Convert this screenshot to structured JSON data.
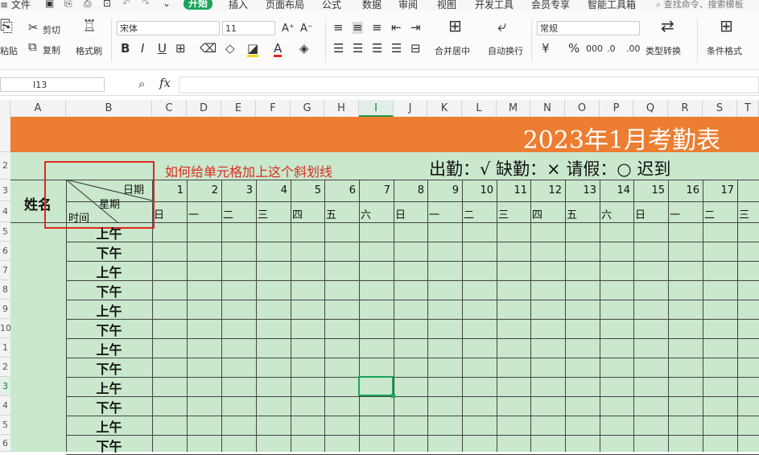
{
  "menu": {
    "file": "文件",
    "tabs": [
      "开始",
      "插入",
      "页面布局",
      "公式",
      "数据",
      "审阅",
      "视图",
      "开发工具",
      "会员专享",
      "智能工具箱"
    ],
    "search_placeholder": "查找命令、搜索模板"
  },
  "ribbon": {
    "paste": "粘贴",
    "cut": "剪切",
    "copy": "复制",
    "format_painter": "格式刷",
    "font_name": "宋体",
    "font_size": "11",
    "merge_center": "合并居中",
    "wrap_text": "自动换行",
    "number_format": "常规",
    "type_convert": "类型转换",
    "conditional_format": "条件格式"
  },
  "formula_bar": {
    "name_box": "I13",
    "fx": "fx",
    "value": ""
  },
  "columns": [
    "A",
    "B",
    "C",
    "D",
    "E",
    "F",
    "G",
    "H",
    "I",
    "J",
    "K",
    "L",
    "M",
    "N",
    "O",
    "P",
    "Q",
    "R",
    "S",
    "T"
  ],
  "selected_column": "I",
  "row_numbers": [
    "",
    "2",
    "3",
    "4",
    "5",
    "6",
    "7",
    "8",
    "9",
    "10",
    "1",
    "2",
    "3",
    "4",
    "5",
    "6"
  ],
  "sheet": {
    "title": "2023年1月考勤表",
    "annotation": "如何给单元格加上这个斜划线",
    "legend": "出勤：√   缺勤：×  请假：○  迟到",
    "name_header": "姓名",
    "diag_date": "日期",
    "diag_weekday": "星期",
    "diag_time": "时间",
    "days": [
      "1",
      "2",
      "3",
      "4",
      "5",
      "6",
      "7",
      "8",
      "9",
      "10",
      "11",
      "12",
      "13",
      "14",
      "15",
      "16",
      "17"
    ],
    "weekdays": [
      "日",
      "一",
      "二",
      "三",
      "四",
      "五",
      "六",
      "日",
      "一",
      "二",
      "三",
      "四",
      "五",
      "六",
      "日",
      "一",
      "二",
      "三"
    ],
    "ampm": [
      "上午",
      "下午",
      "上午",
      "下午",
      "上午",
      "下午",
      "上午",
      "下午",
      "上午",
      "下午",
      "上午",
      "下午"
    ]
  },
  "colors": {
    "title_band": "#ec7d31",
    "sheet_fill": "#c9e8cd",
    "annotation_red": "#e0281e",
    "active_tab": "#1aa55a"
  }
}
